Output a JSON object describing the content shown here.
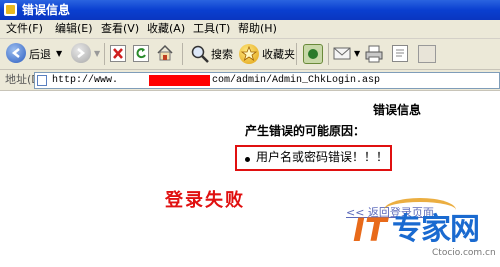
{
  "window": {
    "title": "错误信息"
  },
  "menu": [
    "文件(F)",
    "编辑(E)",
    "查看(V)",
    "收藏(A)",
    "工具(T)",
    "帮助(H)"
  ],
  "toolbar": {
    "back_label": "后退",
    "search_label": "搜索",
    "favorites_label": "收藏夹"
  },
  "address": {
    "label": "地址(D)",
    "url_prefix": "http://www.",
    "url_suffix": "com/admin/Admin_ChkLogin.asp"
  },
  "page": {
    "heading": "错误信息",
    "reasons_title": "产生错误的可能原因：",
    "errors": [
      "用户名或密码错误！！！"
    ],
    "login_failed": "登录失败",
    "back_link": "<< 返回登录页面"
  },
  "watermark": {
    "brand_latin": "IT",
    "brand_cn": "专家网",
    "url": "Ctocio.com.cn"
  }
}
